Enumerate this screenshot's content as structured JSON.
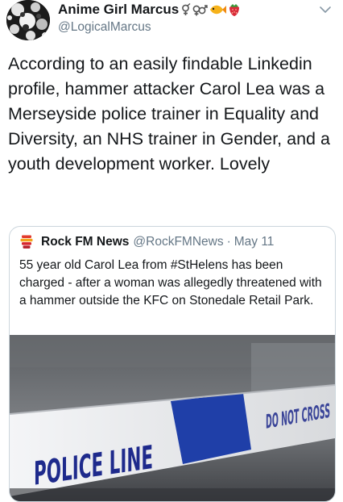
{
  "user": {
    "display_name": "Anime Girl Marcus",
    "handle": "@LogicalMarcus",
    "name_emoji": [
      "gender-symbol-icon",
      "male-female-symbol-icon",
      "fish-icon",
      "strawberry-icon"
    ]
  },
  "tweet": {
    "text": "According to an easily findable Linkedin profile, hammer attacker Carol Lea was a Merseyside police trainer in Equality and Diversity, an NHS trainer in Gender, and a youth development worker. Lovely"
  },
  "quoted": {
    "name": "Rock FM News",
    "handle": "@RockFMNews",
    "separator": "·",
    "date": "May 11",
    "text": "55 year old Carol Lea from #StHelens has been charged - after a woman was allegedly threatened with a hammer outside the KFC on Stonedale Retail Park.",
    "image": {
      "tape_text_main": "POLICE LINE",
      "tape_text_far": "DO NOT CROSS"
    }
  },
  "colors": {
    "text": "#14171a",
    "secondary": "#657786",
    "border": "#ccd6dd",
    "tape_blue": "#1f3fa8"
  }
}
